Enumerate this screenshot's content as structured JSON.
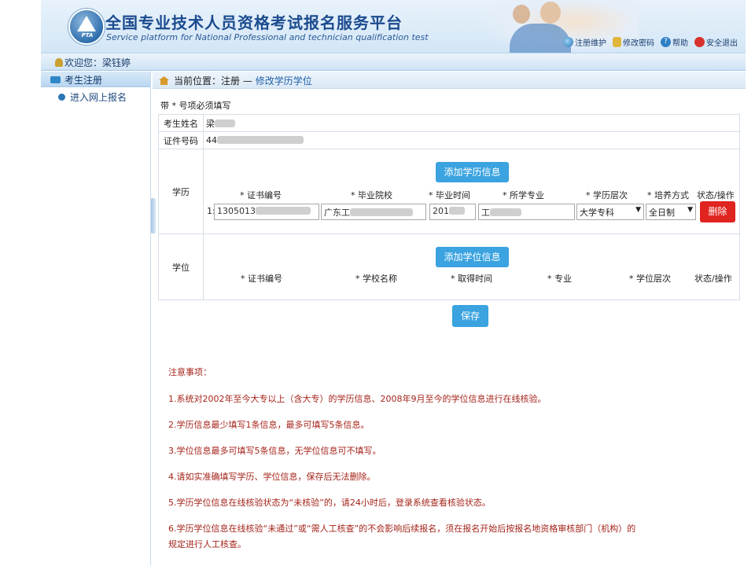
{
  "header": {
    "logo_text": "PTA",
    "title_cn": "全国专业技术人员资格考试报名服务平台",
    "title_en": "Service platform for National Professional and technician qualification test",
    "links": [
      {
        "label": "注册维护",
        "icon": "register-icon"
      },
      {
        "label": "修改密码",
        "icon": "lock-icon"
      },
      {
        "label": "帮助",
        "icon": "help-icon"
      },
      {
        "label": "安全退出",
        "icon": "logout-icon"
      }
    ]
  },
  "welcome": {
    "prefix": "欢迎您：",
    "user": "梁钰婷"
  },
  "sidebar": {
    "title": "考生注册",
    "items": [
      {
        "label": "进入网上报名"
      }
    ]
  },
  "breadcrumb": {
    "prefix": "当前位置：",
    "part1": "注册",
    "sep": "—",
    "part2": "修改学历学位"
  },
  "form": {
    "required_note": "带 * 号项必须填写",
    "name_label": "考生姓名",
    "name_value": "梁",
    "id_label": "证件号码",
    "id_value": "44",
    "education": {
      "label": "学历",
      "add_button": "添加学历信息",
      "columns": [
        "* 证书编号",
        "* 毕业院校",
        "* 毕业时间",
        "* 所学专业",
        "* 学历层次",
        "* 培养方式",
        "状态/操作"
      ],
      "row": {
        "index": "1:",
        "cert_no": "1305013",
        "school": "广东工",
        "grad_time": "201",
        "major": "工",
        "level": "大学专科",
        "mode": "全日制",
        "delete_button": "删除"
      }
    },
    "degree": {
      "label": "学位",
      "add_button": "添加学位信息",
      "columns": [
        "* 证书编号",
        "* 学校名称",
        "* 取得时间",
        "* 专业",
        "* 学位层次",
        "状态/操作"
      ]
    },
    "save_button": "保存"
  },
  "notes": {
    "title": "注意事项：",
    "items": [
      "1.系统对2002年至今大专以上（含大专）的学历信息、2008年9月至今的学位信息进行在线核验。",
      "2.学历信息最少填写1条信息，最多可填写5条信息。",
      "3.学位信息最多可填写5条信息，无学位信息可不填写。",
      "4.请如实准确填写学历、学位信息，保存后无法删除。",
      "5.学历学位信息在线核验状态为“未核验”的，请24小时后，登录系统查看核验状态。",
      "6.学历学位信息在线核验“未通过”或“需人工核查”的不会影响后续报名，须在报名开始后按报名地资格审核部门（机构）的",
      "规定进行人工核查。"
    ]
  },
  "colors": {
    "accent": "#3aa3e0",
    "danger": "#e0241f",
    "note_text": "#a5241a",
    "title": "#1b4b8f"
  }
}
